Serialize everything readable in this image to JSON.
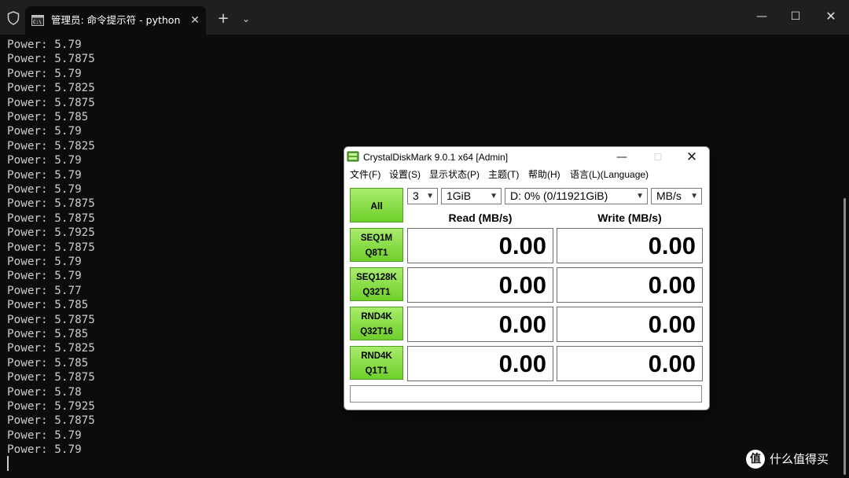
{
  "terminal": {
    "tab_title": "管理员: 命令提示符 - python  ",
    "tab_close_glyph": "✕",
    "new_tab_glyph": "+",
    "dropdown_glyph": "⌄",
    "window_controls": {
      "minimize": "—",
      "maximize": "☐",
      "close": "✕"
    },
    "lines": [
      "Power: 5.79",
      "Power: 5.7875",
      "Power: 5.79",
      "Power: 5.7825",
      "Power: 5.7875",
      "Power: 5.785",
      "Power: 5.79",
      "Power: 5.7825",
      "Power: 5.79",
      "Power: 5.79",
      "Power: 5.79",
      "Power: 5.7875",
      "Power: 5.7875",
      "Power: 5.7925",
      "Power: 5.7875",
      "Power: 5.79",
      "Power: 5.79",
      "Power: 5.77",
      "Power: 5.785",
      "Power: 5.7875",
      "Power: 5.785",
      "Power: 5.7825",
      "Power: 5.785",
      "Power: 5.7875",
      "Power: 5.78",
      "Power: 5.7925",
      "Power: 5.7875",
      "Power: 5.79",
      "Power: 5.79"
    ]
  },
  "crystaldiskmark": {
    "title": "CrystalDiskMark 9.0.1 x64 [Admin]",
    "window_controls": {
      "minimize": "—",
      "maximize": "☐",
      "close": "✕"
    },
    "menu": [
      "文件(F)",
      "设置(S)",
      "显示状态(P)",
      "主题(T)",
      "帮助(H)",
      "语言(L)(Language)"
    ],
    "all_label": "All",
    "count_value": "3",
    "size_value": "1GiB",
    "drive_value": "D: 0% (0/11921GiB)",
    "unit_value": "MB/s",
    "read_header": "Read (MB/s)",
    "write_header": "Write (MB/s)",
    "tests": [
      {
        "line1": "SEQ1M",
        "line2": "Q8T1",
        "read": "0.00",
        "write": "0.00"
      },
      {
        "line1": "SEQ128K",
        "line2": "Q32T1",
        "read": "0.00",
        "write": "0.00"
      },
      {
        "line1": "RND4K",
        "line2": "Q32T16",
        "read": "0.00",
        "write": "0.00"
      },
      {
        "line1": "RND4K",
        "line2": "Q1T1",
        "read": "0.00",
        "write": "0.00"
      }
    ],
    "comment": ""
  },
  "watermark": {
    "logo_glyph": "值",
    "text": "什么值得买"
  },
  "colors": {
    "accent_green": "#7ed63a",
    "terminal_bg": "#0c0c0c",
    "terminal_text": "#cccccc"
  }
}
